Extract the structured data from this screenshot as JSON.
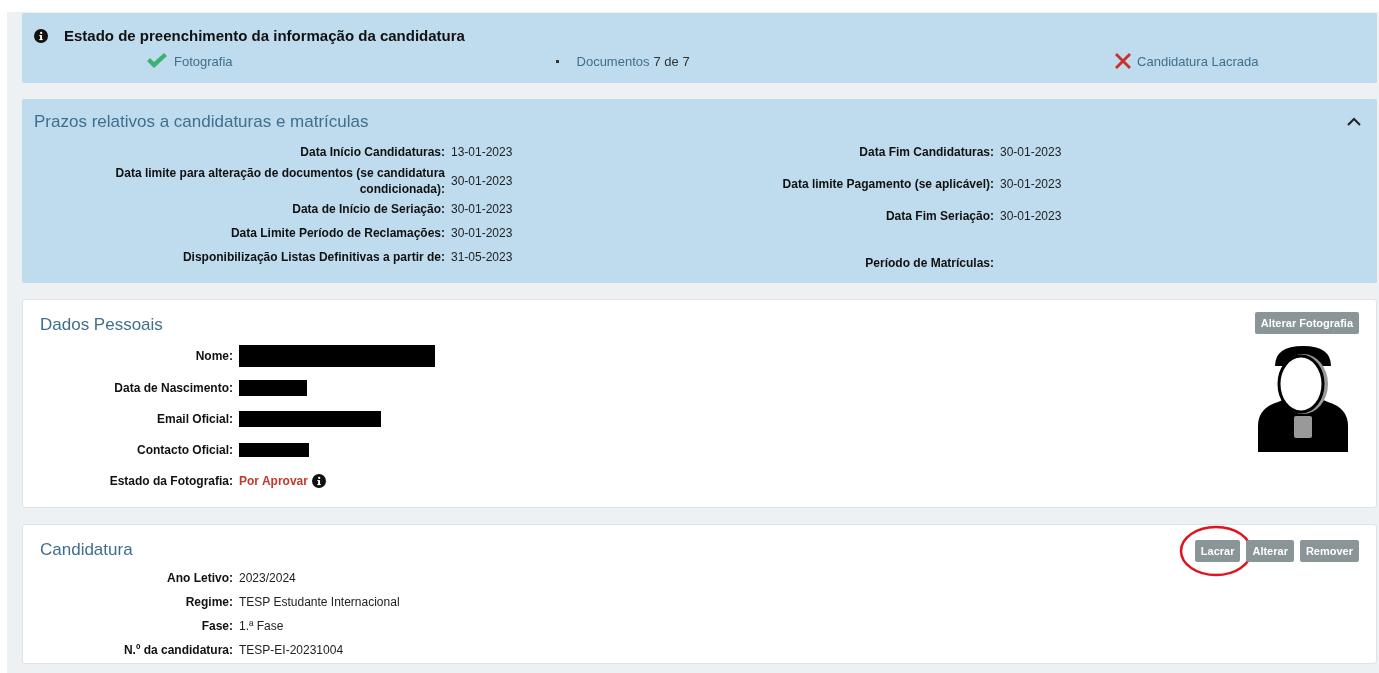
{
  "status_panel": {
    "title": "Estado de preenchimento da informação da candidatura",
    "items": [
      {
        "kind": "check",
        "link": "Fotografia"
      },
      {
        "kind": "bullet",
        "link": "Documentos",
        "text": "7 de 7"
      },
      {
        "kind": "cross",
        "link": "Candidatura Lacrada"
      }
    ]
  },
  "deadlines_panel": {
    "title": "Prazos relativos a candidaturas e matrículas",
    "expanded": true,
    "left": [
      {
        "label": "Data Início Candidaturas:",
        "value": "13-01-2023"
      },
      {
        "label": "Data limite para alteração de documentos (se candidatura condicionada):",
        "value": "30-01-2023"
      },
      {
        "label": "Data de Início de Seriação:",
        "value": "30-01-2023"
      },
      {
        "label": "Data Limite Período de Reclamações:",
        "value": "30-01-2023"
      },
      {
        "label": "Disponibilização Listas Definitivas a partir de:",
        "value": "31-05-2023"
      }
    ],
    "right": [
      {
        "label": "Data Fim Candidaturas:",
        "value": "30-01-2023"
      },
      {
        "label": "Data limite Pagamento (se aplicável):",
        "value": "30-01-2023"
      },
      {
        "label": "Data Fim Seriação:",
        "value": "30-01-2023"
      },
      {
        "label": "Período de Matrículas:"
      }
    ]
  },
  "personal_data": {
    "title": "Dados Pessoais",
    "button": "Alterar Fotografia",
    "fields": [
      {
        "label": "Nome:",
        "redacted": true
      },
      {
        "label": "Data de Nascimento:",
        "redacted": true
      },
      {
        "label": "Email Oficial:",
        "redacted": true
      },
      {
        "label": "Contacto Oficial:",
        "redacted": true
      },
      {
        "label": "Estado da Fotografia:",
        "value": "Por Aprovar",
        "kind": "status"
      }
    ]
  },
  "application": {
    "title": "Candidatura",
    "buttons": [
      {
        "label": "Lacrar",
        "highlighted": true
      },
      {
        "label": "Alterar",
        "highlighted": false
      },
      {
        "label": "Remover",
        "highlighted": false
      }
    ],
    "fields": [
      {
        "label": "Ano Letivo:",
        "value": "2023/2024"
      },
      {
        "label": "Regime:",
        "value": "TESP Estudante Internacional"
      },
      {
        "label": "Fase:",
        "value": "1.ª Fase"
      },
      {
        "label": "N.º da candidatura:",
        "value": "TESP-EI-20231004"
      }
    ]
  }
}
